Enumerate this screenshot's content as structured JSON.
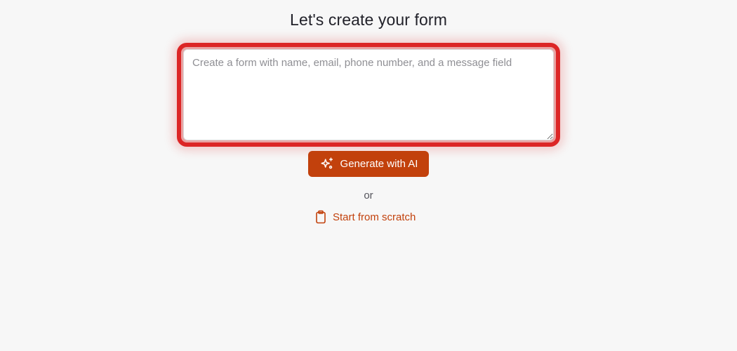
{
  "heading": "Let's create your form",
  "prompt": {
    "value": "",
    "placeholder": "Create a form with name, email, phone number, and a message field"
  },
  "generate_button": {
    "label": "Generate with AI",
    "icon": "sparkles-icon"
  },
  "separator_text": "or",
  "scratch_link": {
    "label": "Start from scratch",
    "icon": "clipboard-icon"
  },
  "colors": {
    "accent": "#c2410c",
    "focus_ring": "#dc2626",
    "background": "#f7f7f7"
  }
}
